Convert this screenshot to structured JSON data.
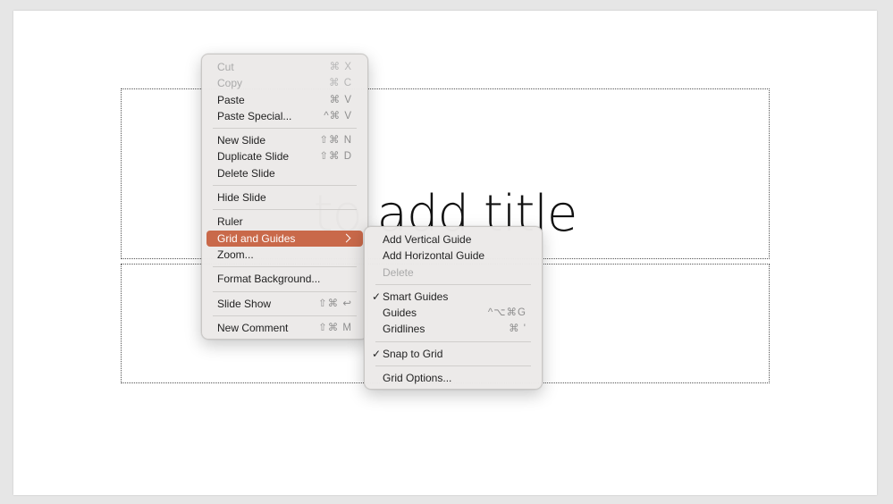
{
  "slide": {
    "title_placeholder_text": "to add title"
  },
  "context_menu": {
    "items": [
      {
        "label": "Cut",
        "shortcut": "⌘ X",
        "disabled": true
      },
      {
        "label": "Copy",
        "shortcut": "⌘ C",
        "disabled": true
      },
      {
        "label": "Paste",
        "shortcut": "⌘ V"
      },
      {
        "label": "Paste Special...",
        "shortcut": "^⌘ V"
      },
      {
        "label": "New Slide",
        "shortcut": "⇧⌘ N"
      },
      {
        "label": "Duplicate Slide",
        "shortcut": "⇧⌘ D"
      },
      {
        "label": "Delete Slide",
        "shortcut": ""
      },
      {
        "label": "Hide Slide",
        "shortcut": ""
      },
      {
        "label": "Ruler",
        "shortcut": ""
      },
      {
        "label": "Grid and Guides",
        "shortcut": "",
        "active": true
      },
      {
        "label": "Zoom...",
        "shortcut": ""
      },
      {
        "label": "Format Background...",
        "shortcut": ""
      },
      {
        "label": "Slide Show",
        "shortcut": "⇧⌘ ↩"
      },
      {
        "label": "New Comment",
        "shortcut": "⇧⌘ M"
      }
    ]
  },
  "grid_submenu": {
    "items": [
      {
        "label": "Add Vertical Guide",
        "shortcut": ""
      },
      {
        "label": "Add Horizontal Guide",
        "shortcut": ""
      },
      {
        "label": "Delete",
        "shortcut": "",
        "disabled": true
      },
      {
        "label": "Smart Guides",
        "shortcut": "",
        "checked": true
      },
      {
        "label": "Guides",
        "shortcut": "^⌥⌘G"
      },
      {
        "label": "Gridlines",
        "shortcut": "⌘ '"
      },
      {
        "label": "Snap to Grid",
        "shortcut": "",
        "checked": true
      },
      {
        "label": "Grid Options...",
        "shortcut": ""
      }
    ],
    "check_glyph": "✓"
  },
  "colors": {
    "highlight": "#c9694a",
    "background": "#e6e6e6"
  }
}
